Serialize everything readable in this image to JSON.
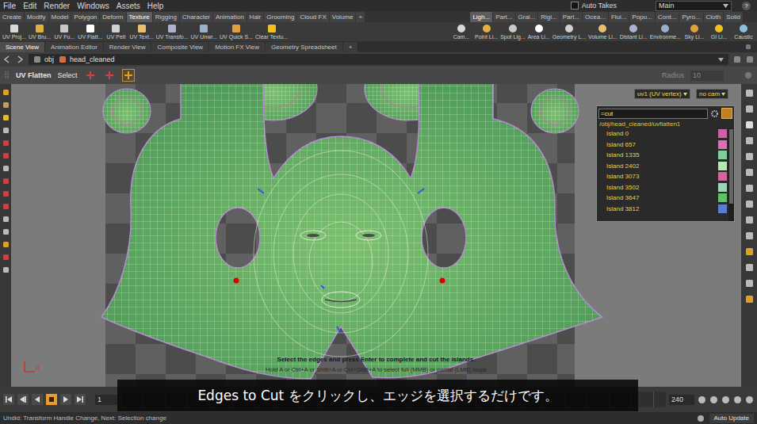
{
  "menu": [
    "File",
    "Edit",
    "Render",
    "Windows",
    "Assets",
    "Help"
  ],
  "auto_takes": {
    "label": "Auto Takes",
    "checked": false
  },
  "desktop": "Main",
  "help_icon": "?",
  "shelf_tabs": [
    {
      "label": "Create",
      "selected": false
    },
    {
      "label": "Modify",
      "selected": false
    },
    {
      "label": "Model",
      "selected": false
    },
    {
      "label": "Polygon",
      "selected": false
    },
    {
      "label": "Deform",
      "selected": false
    },
    {
      "label": "Texture",
      "selected": true
    },
    {
      "label": "Rigging",
      "selected": false
    },
    {
      "label": "Character",
      "selected": false
    },
    {
      "label": "Animation",
      "selected": false
    },
    {
      "label": "Hair",
      "selected": false
    },
    {
      "label": "Grooming",
      "selected": false
    },
    {
      "label": "Cloud FX",
      "selected": false
    },
    {
      "label": "Volume",
      "selected": false
    },
    {
      "label": "+",
      "selected": false
    }
  ],
  "shelf_tabs_right": [
    {
      "label": "Ligh...",
      "selected": true
    },
    {
      "label": "Part...",
      "selected": false
    },
    {
      "label": "Grai...",
      "selected": false
    },
    {
      "label": "Rigi...",
      "selected": false
    },
    {
      "label": "Part...",
      "selected": false
    },
    {
      "label": "Ocea...",
      "selected": false
    },
    {
      "label": "Flui...",
      "selected": false
    },
    {
      "label": "Popu...",
      "selected": false
    },
    {
      "label": "Cont...",
      "selected": false
    },
    {
      "label": "Pyro...",
      "selected": false
    },
    {
      "label": "Cloth",
      "selected": false
    },
    {
      "label": "Solid",
      "selected": false
    }
  ],
  "shelf_tools": [
    "UV Proj...",
    "UV Bru...",
    "UV Fu...",
    "UV Flatt...",
    "UV Pelt",
    "UV Text...",
    "UV Transfo...",
    "UV Unwr...",
    "UV Quick S...",
    "Clear Textu..."
  ],
  "shelf_tools_right": [
    "Cam...",
    "Point Li...",
    "Spot Lig...",
    "Area Li...",
    "Geometry L...",
    "Volume Li...",
    "Distant Li...",
    "Environme...",
    "Sky Li...",
    "GI Li...",
    "Caustic"
  ],
  "pane_tabs": [
    {
      "label": "Scene View",
      "selected": true
    },
    {
      "label": "Animation Editor",
      "selected": false
    },
    {
      "label": "Render View",
      "selected": false
    },
    {
      "label": "Composite View",
      "selected": false
    },
    {
      "label": "Motion FX View",
      "selected": false
    },
    {
      "label": "Geometry Spreadsheet",
      "selected": false
    },
    {
      "label": "+",
      "selected": false
    }
  ],
  "path": [
    "obj",
    "head_cleaned"
  ],
  "tool": {
    "name": "UV Flatten",
    "mode": "Select",
    "radius_label": "Radius",
    "radius_value": "10"
  },
  "viewport": {
    "uv_attribute": "uv1 (UV vertex)",
    "camera": "no cam",
    "axis_label": "u",
    "hint": "Select the edges and press Enter to complete and cut the islands.",
    "hint_keys": "Hold A or Ctrl+A or Shift+A or Ctrl+Shift+A to select full (MMB) or partial (LMB) loops"
  },
  "island_panel": {
    "filter": "=cut",
    "node_path": "/obj/head_cleaned/uvflatten1",
    "islands": [
      {
        "label": "Island 0",
        "color": "#cf5fa6"
      },
      {
        "label": "Island 657",
        "color": "#d872b4"
      },
      {
        "label": "Island 1335",
        "color": "#7fcf9a"
      },
      {
        "label": "Island 2402",
        "color": "#b8e7b0"
      },
      {
        "label": "Island 3073",
        "color": "#d266a3"
      },
      {
        "label": "Island 3502",
        "color": "#9ad6b8"
      },
      {
        "label": "Island 3647",
        "color": "#62c06a"
      },
      {
        "label": "Island 3812",
        "color": "#5a7fd2"
      }
    ]
  },
  "subtitle": "Edges to Cut をクリックし、エッジを選択するだけです。",
  "playback": [
    {
      "kind": "first",
      "selected": false
    },
    {
      "kind": "prev",
      "selected": false
    },
    {
      "kind": "reverse",
      "selected": false
    },
    {
      "kind": "stop",
      "selected": true
    },
    {
      "kind": "play",
      "selected": false
    },
    {
      "kind": "last",
      "selected": false
    }
  ],
  "timeline": {
    "start_frame": "1",
    "end_frame": "240"
  },
  "status_bar": {
    "message": "Undid: Transform Handle Change, Next: Selection change",
    "auto_update": "Auto Update"
  }
}
